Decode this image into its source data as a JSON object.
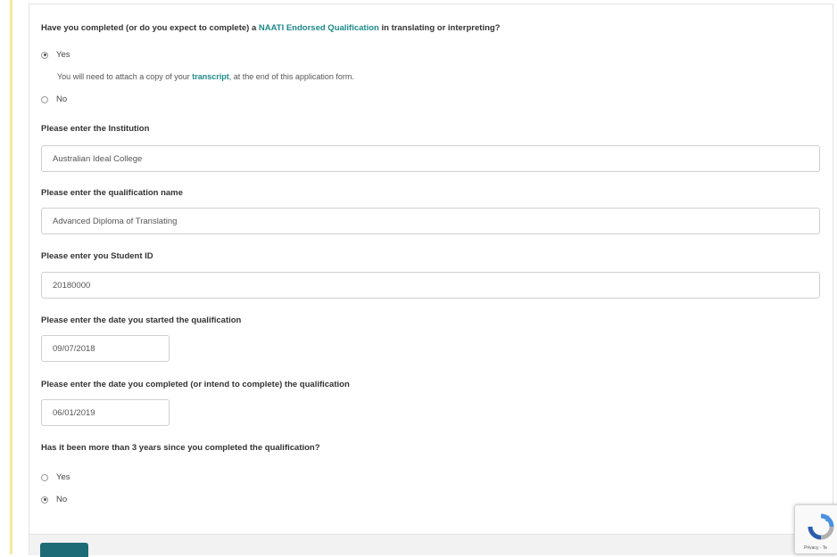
{
  "q1": {
    "prefix": "Have you completed (or do you expect to complete) a ",
    "link": "NAATI Endorsed Qualification",
    "suffix": " in translating or interpreting?",
    "options": [
      {
        "label": "Yes",
        "checked": true
      },
      {
        "label": "No",
        "checked": false
      }
    ],
    "note": {
      "prefix": "You will need to attach a copy of your ",
      "link": "transcript",
      "suffix": ", at the end of this application form."
    }
  },
  "institution": {
    "label": "Please enter the Institution",
    "value": "Australian Ideal College"
  },
  "qualification": {
    "label": "Please enter the qualification name",
    "value": "Advanced Diploma of Translating"
  },
  "student_id": {
    "label": "Please enter you Student ID",
    "value": "20180000"
  },
  "start_date": {
    "label": "Please enter the date you started the qualification",
    "value": "09/07/2018"
  },
  "end_date": {
    "label": "Please enter the date you completed (or intend to complete) the qualification",
    "value": "06/01/2019"
  },
  "q2": {
    "label": "Has it been more than 3 years since you completed the qualification?",
    "options": [
      {
        "label": "Yes",
        "checked": false
      },
      {
        "label": "No",
        "checked": true
      }
    ]
  },
  "recaptcha": {
    "text": "Privacy - Te"
  },
  "colors": {
    "accent": "#1e6b78",
    "link": "#1e8a8a",
    "left_border": "#f6e79a"
  }
}
